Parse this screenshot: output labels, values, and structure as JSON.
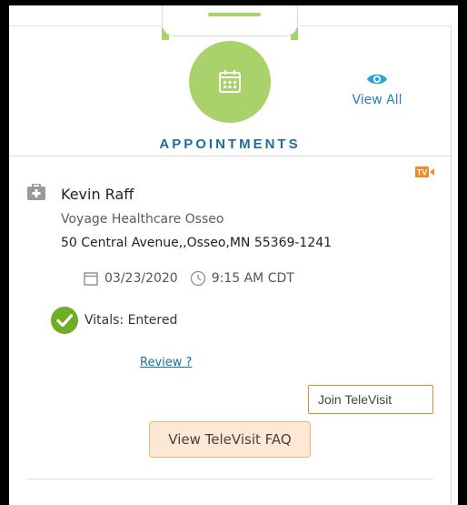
{
  "header": {
    "title": "APPOINTMENTS",
    "view_all_label": "View All"
  },
  "appointment": {
    "provider_name": "Kevin Raff",
    "clinic_name": "Voyage Healthcare Osseo",
    "address": "50 Central Avenue,,Osseo,MN 55369-1241",
    "date": "03/23/2020",
    "time": "9:15 AM CDT",
    "vitals_status": "Vitals: Entered",
    "review_label": "Review ?",
    "badge_text": "TV"
  },
  "actions": {
    "join_label": "Join TeleVisit",
    "faq_label": "View TeleVisit FAQ"
  },
  "colors": {
    "accent_green": "#a9d36a",
    "title_blue": "#1b6fa3",
    "televisit_orange": "#e58a2e"
  }
}
